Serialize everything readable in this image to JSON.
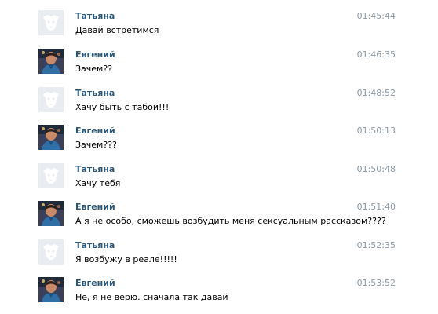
{
  "messages": [
    {
      "author": "Татьяна",
      "text": "Давай встретимся",
      "time": "01:45:44",
      "avatar": "camera-placeholder-icon"
    },
    {
      "author": "Евгений",
      "text": "Зачем??",
      "time": "01:46:35",
      "avatar": "user-photo"
    },
    {
      "author": "Татьяна",
      "text": "Хачу быть с табой!!!",
      "time": "01:48:52",
      "avatar": "camera-placeholder-icon"
    },
    {
      "author": "Евгений",
      "text": "Зачем???",
      "time": "01:50:13",
      "avatar": "user-photo"
    },
    {
      "author": "Татьяна",
      "text": "Хачу тебя",
      "time": "01:50:48",
      "avatar": "camera-placeholder-icon"
    },
    {
      "author": "Евгений",
      "text": "А я не особо, сможешь возбудить меня сексуальным рассказом????",
      "time": "01:51:40",
      "avatar": "user-photo"
    },
    {
      "author": "Татьяна",
      "text": "Я возбужу в реале!!!!!",
      "time": "01:52:35",
      "avatar": "camera-placeholder-icon"
    },
    {
      "author": "Евгений",
      "text": "Не, я не верю. сначала так давай",
      "time": "01:53:52",
      "avatar": "user-photo"
    }
  ],
  "colors": {
    "author": "#2b587a",
    "time": "#8c99a5",
    "text": "#000000",
    "placeholder_bg": "#e9edf1",
    "placeholder_fg": "#ffffff"
  }
}
